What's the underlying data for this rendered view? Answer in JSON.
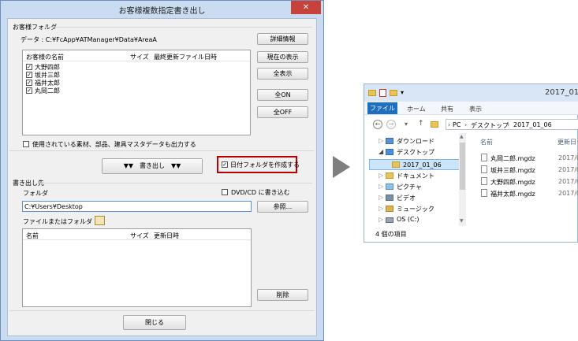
{
  "dialog": {
    "title": "お客様複数指定書き出し",
    "close": "✕",
    "customer_folder_group": "お客様フォルダ",
    "data_path": "データ : C:¥FcApp¥ATManager¥Data¥AreaA",
    "list_headers": {
      "name": "お客様の名前",
      "size": "サイズ",
      "updated": "最終更新ファイル日時"
    },
    "customers": [
      "大野四郎",
      "坂井三郎",
      "福井太郎",
      "丸岡二郎"
    ],
    "buttons": {
      "detail": "詳細情報",
      "show_current": "現在の表示",
      "show_all": "全表示",
      "all_on": "全ON",
      "all_off": "全OFF",
      "export": "▼▼　書き出し　▼▼",
      "browse": "参照...",
      "delete": "削除",
      "close": "閉じる"
    },
    "also_output_materials": "使用されている素材、部品、建具マスタデータも出力する",
    "date_folder_checkbox": "日付フォルダを作成する",
    "export_dest_group": "書き出し先",
    "folder_label": "フォルダ",
    "dvd_label": "DVD/CD に書き込む",
    "folder_value": "C:¥Users¥Desktop",
    "file_or_folder_label": "ファイルまたはフォルダ",
    "file_headers": {
      "name": "名前",
      "size": "サイズ",
      "updated": "更新日時"
    }
  },
  "explorer": {
    "title": "2017_01",
    "tabs": [
      "ファイル",
      "ホーム",
      "共有",
      "表示"
    ],
    "nav": {
      "back": "←",
      "forward": "→",
      "down": "▾",
      "up": "↑"
    },
    "breadcrumb": [
      "PC",
      "デスクトップ",
      "2017_01_06"
    ],
    "tree": [
      "ダウンロード",
      "デスクトップ",
      "2017_01_06",
      "ドキュメント",
      "ピクチャ",
      "ビデオ",
      "ミュージック",
      "OS (C:)"
    ],
    "columns": {
      "name": "名前",
      "updated": "更新日"
    },
    "files": [
      "丸岡二郎.mgdz",
      "坂井三郎.mgdz",
      "大野四郎.mgdz",
      "福井太郎.mgdz"
    ],
    "file_dates": [
      "2017/0",
      "2017/0",
      "2017/0",
      "2017/0"
    ],
    "status": "4 個の項目"
  },
  "colors": {
    "highlight_border": "#c00000",
    "explorer_file_tab": "#1e6fc2",
    "close_button": "#c7423a"
  }
}
